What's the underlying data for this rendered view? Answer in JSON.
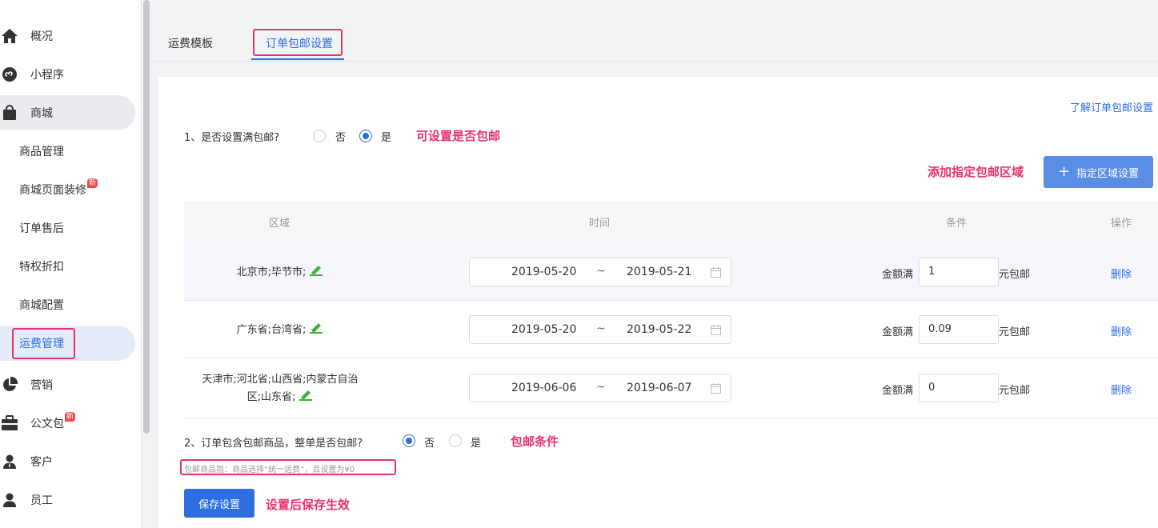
{
  "sidebar": {
    "items": [
      {
        "label": "概况",
        "icon": "home-icon"
      },
      {
        "label": "小程序",
        "icon": "mini-program-icon"
      },
      {
        "label": "商城",
        "icon": "shopping-bag-icon"
      },
      {
        "label": "商品管理"
      },
      {
        "label": "商城页面装修",
        "badge": "新"
      },
      {
        "label": "订单售后"
      },
      {
        "label": "特权折扣"
      },
      {
        "label": "商城配置"
      },
      {
        "label": "运费管理"
      },
      {
        "label": "营销",
        "icon": "pie-chart-icon"
      },
      {
        "label": "公文包",
        "icon": "briefcase-icon",
        "badge": "新"
      },
      {
        "label": "客户",
        "icon": "customer-icon"
      },
      {
        "label": "员工",
        "icon": "employee-icon"
      }
    ]
  },
  "tabs": [
    {
      "label": "运费模板"
    },
    {
      "label": "订单包邮设置"
    }
  ],
  "help_link": "了解订单包邮设置",
  "q1": {
    "label": "1、是否设置满包邮?",
    "options": [
      "否",
      "是"
    ],
    "selected": "是",
    "annotation": "可设置是否包邮"
  },
  "add_region": {
    "annotation": "添加指定包邮区域",
    "button_label": "指定区域设置"
  },
  "table": {
    "headers": [
      "区域",
      "时间",
      "条件",
      "操作"
    ],
    "rows": [
      {
        "region": "北京市;毕节市;",
        "start": "2019-05-20",
        "end": "2019-05-21",
        "cond_pre": "金额满",
        "amount": "1",
        "cond_post": "元包邮",
        "action": "删除"
      },
      {
        "region": "广东省;台湾省;",
        "start": "2019-05-20",
        "end": "2019-05-22",
        "cond_pre": "金额满",
        "amount": "0.09",
        "cond_post": "元包邮",
        "action": "删除"
      },
      {
        "region_line1": "天津市;河北省;山西省;内蒙古自治",
        "region_line2": "区;山东省;",
        "start": "2019-06-06",
        "end": "2019-06-07",
        "cond_pre": "金额满",
        "amount": "0",
        "cond_post": "元包邮",
        "action": "删除"
      }
    ],
    "separator": "~"
  },
  "q2": {
    "label": "2、订单包含包邮商品，整单是否包邮?",
    "options": [
      "否",
      "是"
    ],
    "selected": "否",
    "annotation": "包邮条件",
    "note": "包邮商品指：商品选择“统一运费”，且设置为¥0"
  },
  "save": {
    "button_label": "保存设置",
    "annotation": "设置后保存生效"
  },
  "colors": {
    "accent": "#2d6ee0",
    "annotation": "#e8326b"
  }
}
